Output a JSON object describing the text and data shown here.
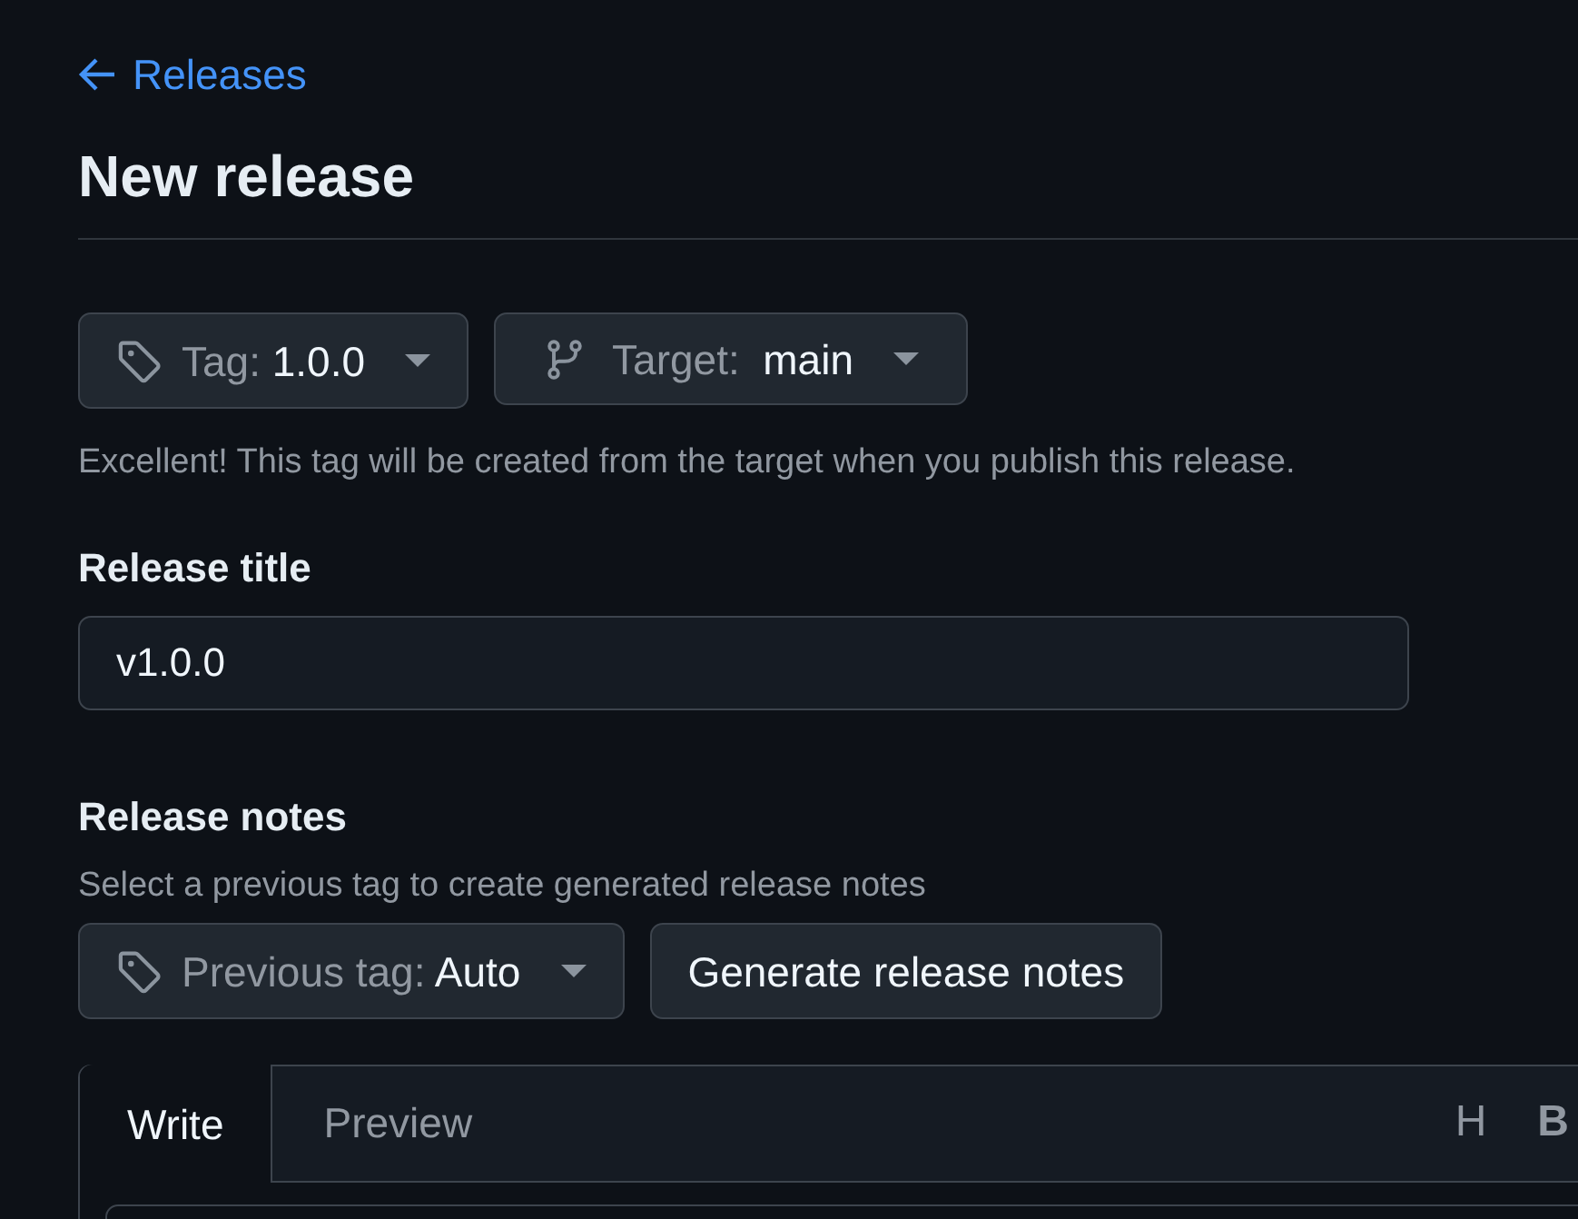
{
  "back_link": {
    "label": "Releases"
  },
  "title": "New release",
  "tag_picker": {
    "label": "Tag:",
    "value": "1.0.0"
  },
  "target_picker": {
    "label": "Target:",
    "value": "main"
  },
  "tag_note": "Excellent! This tag will be created from the target when you publish this release.",
  "release_title": {
    "label": "Release title",
    "value": "v1.0.0"
  },
  "release_notes": {
    "label": "Release notes",
    "hint": "Select a previous tag to create generated release notes",
    "previous_tag": {
      "label": "Previous tag:",
      "value": "Auto"
    },
    "generate_button": "Generate release notes"
  },
  "editor": {
    "tabs": [
      {
        "label": "Write",
        "selected": true
      },
      {
        "label": "Preview",
        "selected": false
      }
    ],
    "toolbar": [
      {
        "kind": "heading",
        "label": "H"
      },
      {
        "kind": "bold",
        "label": "B"
      }
    ]
  }
}
